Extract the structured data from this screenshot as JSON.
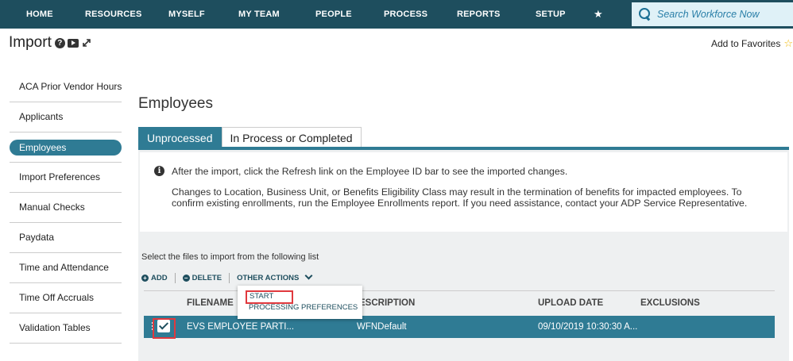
{
  "nav": {
    "items": [
      "HOME",
      "RESOURCES",
      "MYSELF",
      "MY TEAM",
      "PEOPLE",
      "PROCESS",
      "REPORTS",
      "SETUP"
    ],
    "search_placeholder": "Search Workforce Now"
  },
  "header": {
    "title": "Import",
    "favorites": "Add to Favorites"
  },
  "sidebar": {
    "items": [
      "ACA Prior Vendor Hours",
      "Applicants",
      "Employees",
      "Import Preferences",
      "Manual Checks",
      "Paydata",
      "Time and Attendance",
      "Time Off Accruals",
      "Validation Tables"
    ],
    "active": "Employees"
  },
  "main": {
    "title": "Employees",
    "tabs": [
      "Unprocessed",
      "In Process or Completed"
    ],
    "info_line1": "After the import, click the Refresh link on the Employee ID bar to see the imported changes.",
    "info_line2": "Changes to Location, Business Unit, or Benefits Eligibility Class may result in the termination of benefits for impacted employees. To confirm existing enrollments, run the Employee Enrollments report. If you need assistance, contact your ADP Service Representative.",
    "select_text": "Select the files to import from the following list",
    "actions": {
      "add": "ADD",
      "delete": "DELETE",
      "other": "OTHER ACTIONS"
    },
    "dropdown": {
      "start": "START",
      "prefs": "PROCESSING PREFERENCES"
    },
    "table": {
      "headers": [
        "FILENAME",
        "ESCRIPTION",
        "UPLOAD DATE",
        "EXCLUSIONS"
      ],
      "row": {
        "filename": "EVS EMPLOYEE PARTI...",
        "description": "WFNDefault",
        "upload_date": "09/10/2019 10:30:30 A..."
      }
    }
  },
  "colors": {
    "nav_bg": "#1e4e5e",
    "accent": "#2f7b94",
    "highlight": "#e0393e"
  }
}
